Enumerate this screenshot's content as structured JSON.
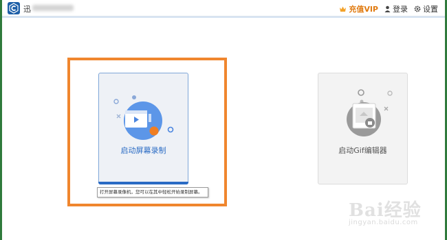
{
  "app": {
    "title_visible_prefix": "迅",
    "title_suffix": "录屏"
  },
  "topbar": {
    "vip_label": "充值VIP",
    "login_label": "登录",
    "settings_label": "设置"
  },
  "cards": {
    "record_label": "启动屏幕录制",
    "record_tooltip": "打开屏幕录像机，您可以在其中轻松开始录制屏幕。",
    "gif_label": "启动Gif编辑器"
  },
  "watermark": {
    "main": "Bai经验",
    "sub": "jingyan.baidu.com"
  },
  "colors": {
    "accent_blue": "#2a6bc4",
    "highlight_orange": "#f0862e",
    "vip_orange": "#e07a10"
  }
}
